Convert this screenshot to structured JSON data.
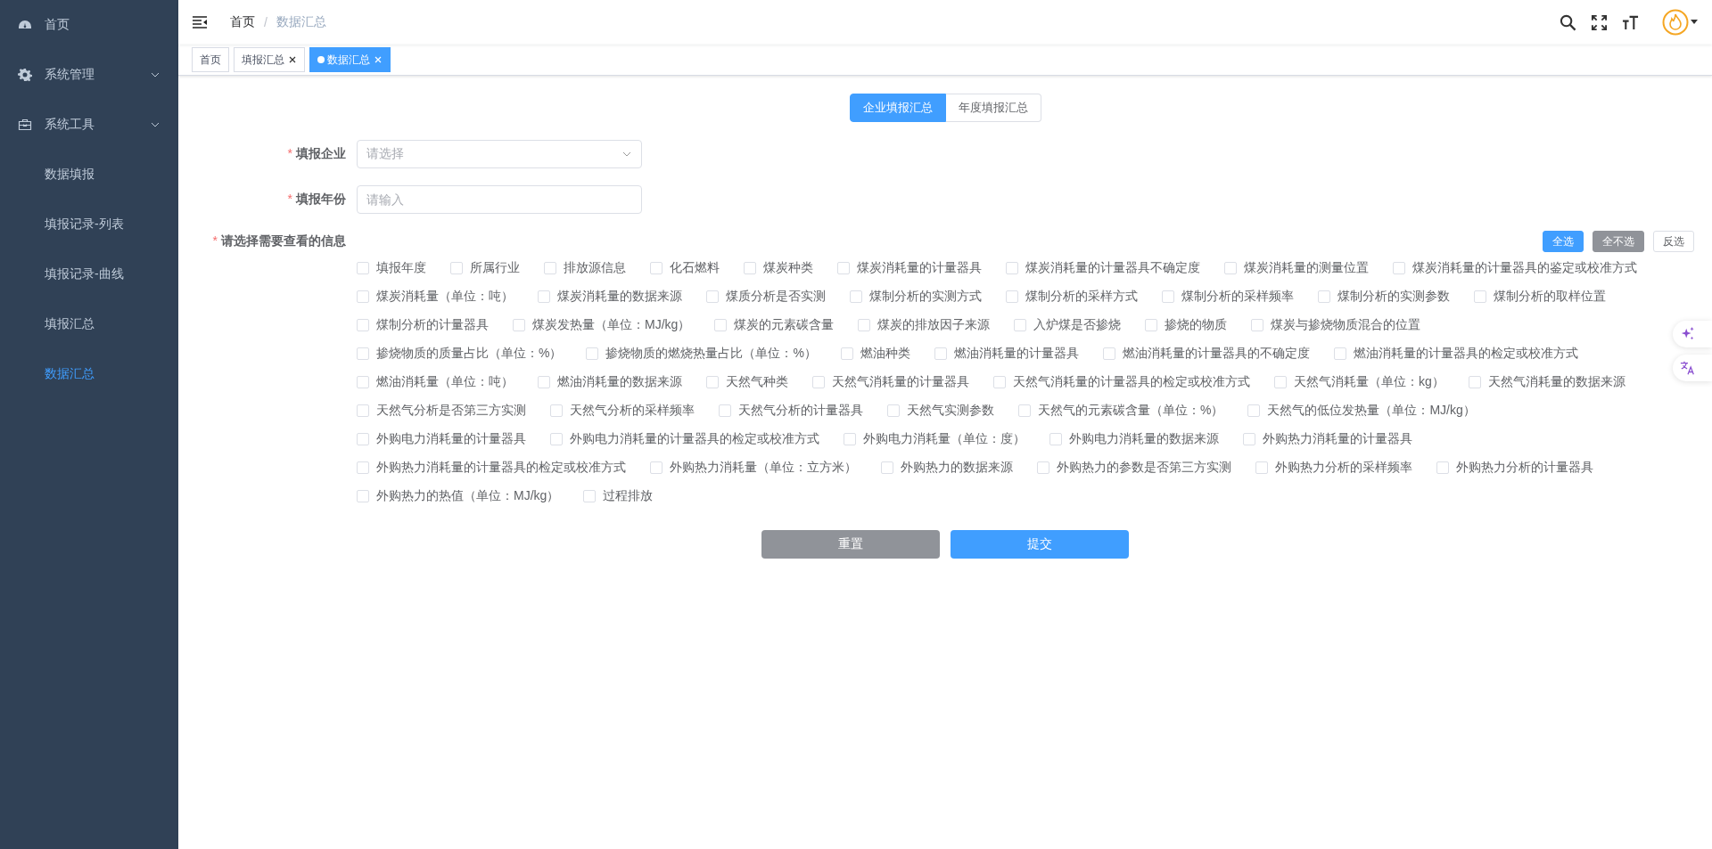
{
  "sidebar": {
    "items": [
      {
        "label": "首页",
        "kind": "link",
        "selected": false
      },
      {
        "label": "系统管理",
        "kind": "group",
        "selected": false
      },
      {
        "label": "系统工具",
        "kind": "group",
        "selected": false,
        "children": [
          {
            "label": "数据填报",
            "selected": false
          },
          {
            "label": "填报记录-列表",
            "selected": false
          },
          {
            "label": "填报记录-曲线",
            "selected": false
          },
          {
            "label": "填报汇总",
            "selected": false
          },
          {
            "label": "数据汇总",
            "selected": true
          }
        ]
      }
    ]
  },
  "breadcrumb": {
    "separator": "/",
    "items": [
      "首页",
      "数据汇总"
    ]
  },
  "tags": [
    {
      "label": "首页",
      "selected": false,
      "closable": false
    },
    {
      "label": "填报汇总",
      "selected": false,
      "closable": true
    },
    {
      "label": "数据汇总",
      "selected": true,
      "closable": true
    }
  ],
  "mode_tabs": [
    {
      "label": "企业填报汇总",
      "selected": true
    },
    {
      "label": "年度填报汇总",
      "selected": false
    }
  ],
  "form": {
    "company": {
      "label": "填报企业",
      "required_mark": "*",
      "placeholder": "请选择"
    },
    "year": {
      "label": "填报年份",
      "required_mark": "*",
      "placeholder": "请输入"
    },
    "info": {
      "label": "请选择需要查看的信息",
      "required_mark": "*"
    },
    "bulk_buttons": [
      {
        "label": "全选",
        "kind": "primary"
      },
      {
        "label": "全不选",
        "kind": "info"
      },
      {
        "label": "反选",
        "kind": "plain"
      }
    ],
    "option_rows": [
      [
        {
          "label": "填报年度",
          "checked": false
        },
        {
          "label": "所属行业",
          "checked": false
        },
        {
          "label": "排放源信息",
          "checked": false
        },
        {
          "label": "化石燃料",
          "checked": false
        },
        {
          "label": "煤炭种类",
          "checked": false
        },
        {
          "label": "煤炭消耗量的计量器具",
          "checked": false
        },
        {
          "label": "煤炭消耗量的计量器具不确定度",
          "checked": false
        },
        {
          "label": "煤炭消耗量的测量位置",
          "checked": false
        },
        {
          "label": "煤炭消耗量的计量器具的鉴定或校准方式",
          "checked": false
        }
      ],
      [
        {
          "label": "煤炭消耗量（单位：吨）",
          "checked": false
        },
        {
          "label": "煤炭消耗量的数据来源",
          "checked": false
        },
        {
          "label": "煤质分析是否实测",
          "checked": false
        },
        {
          "label": "煤制分析的实测方式",
          "checked": false
        },
        {
          "label": "煤制分析的采样方式",
          "checked": false
        },
        {
          "label": "煤制分析的采样频率",
          "checked": false
        },
        {
          "label": "煤制分析的实测参数",
          "checked": false
        },
        {
          "label": "煤制分析的取样位置",
          "checked": false
        }
      ],
      [
        {
          "label": "煤制分析的计量器具",
          "checked": false
        },
        {
          "label": "煤炭发热量（单位：MJ/kg）",
          "checked": false
        },
        {
          "label": "煤炭的元素碳含量",
          "checked": false
        },
        {
          "label": "煤炭的排放因子来源",
          "checked": false
        },
        {
          "label": "入炉煤是否掺烧",
          "checked": false
        },
        {
          "label": "掺烧的物质",
          "checked": false
        },
        {
          "label": "煤炭与掺烧物质混合的位置",
          "checked": false
        }
      ],
      [
        {
          "label": "掺烧物质的质量占比（单位：%）",
          "checked": false
        },
        {
          "label": "掺烧物质的燃烧热量占比（单位：%）",
          "checked": false
        },
        {
          "label": "燃油种类",
          "checked": false
        },
        {
          "label": "燃油消耗量的计量器具",
          "checked": false
        },
        {
          "label": "燃油消耗量的计量器具的不确定度",
          "checked": false
        },
        {
          "label": "燃油消耗量的计量器具的检定或校准方式",
          "checked": false
        }
      ],
      [
        {
          "label": "燃油消耗量（单位：吨）",
          "checked": false
        },
        {
          "label": "燃油消耗量的数据来源",
          "checked": false
        },
        {
          "label": "天然气种类",
          "checked": false
        },
        {
          "label": "天然气消耗量的计量器具",
          "checked": false
        },
        {
          "label": "天然气消耗量的计量器具的检定或校准方式",
          "checked": false
        },
        {
          "label": "天然气消耗量（单位：kg）",
          "checked": false
        },
        {
          "label": "天然气消耗量的数据来源",
          "checked": false
        }
      ],
      [
        {
          "label": "天然气分析是否第三方实测",
          "checked": false
        },
        {
          "label": "天然气分析的采样频率",
          "checked": false
        },
        {
          "label": "天然气分析的计量器具",
          "checked": false
        },
        {
          "label": "天然气实测参数",
          "checked": false
        },
        {
          "label": "天然气的元素碳含量（单位：%）",
          "checked": false
        },
        {
          "label": "天然气的低位发热量（单位：MJ/kg）",
          "checked": false
        }
      ],
      [
        {
          "label": "外购电力消耗量的计量器具",
          "checked": false
        },
        {
          "label": "外购电力消耗量的计量器具的检定或校准方式",
          "checked": false
        },
        {
          "label": "外购电力消耗量（单位：度）",
          "checked": false
        },
        {
          "label": "外购电力消耗量的数据来源",
          "checked": false
        },
        {
          "label": "外购热力消耗量的计量器具",
          "checked": false
        }
      ],
      [
        {
          "label": "外购热力消耗量的计量器具的检定或校准方式",
          "checked": false
        },
        {
          "label": "外购热力消耗量（单位：立方米）",
          "checked": false
        },
        {
          "label": "外购热力的数据来源",
          "checked": false
        },
        {
          "label": "外购热力的参数是否第三方实测",
          "checked": false
        },
        {
          "label": "外购热力分析的采样频率",
          "checked": false
        },
        {
          "label": "外购热力分析的计量器具",
          "checked": false
        }
      ],
      [
        {
          "label": "外购热力的热值（单位：MJ/kg）",
          "checked": false
        },
        {
          "label": "过程排放",
          "checked": false
        }
      ]
    ],
    "actions": [
      {
        "label": "重置",
        "kind": "info"
      },
      {
        "label": "提交",
        "kind": "primary"
      }
    ]
  }
}
